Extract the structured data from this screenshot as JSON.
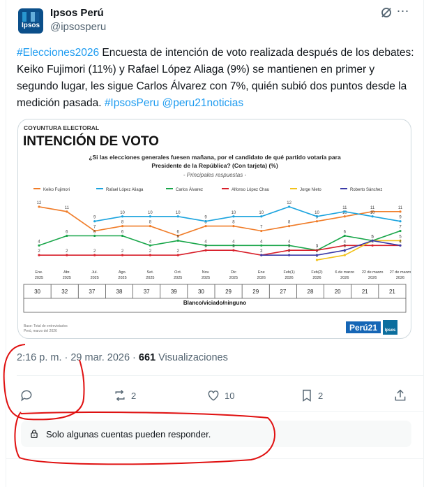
{
  "author": {
    "name": "Ipsos Perú",
    "handle": "@ipsosperu",
    "avatar_text": "Ipsos"
  },
  "tweet": {
    "hashtag1": "#Elecciones2026",
    "text1": " Encuesta de intención de voto realizada después de los debates: Keiko Fujimori (11%) y Rafael López Aliaga (9%) se mantienen en primer y segundo lugar, les sigue Carlos Álvarez con 7%, quién subió dos puntos desde la medición pasada. ",
    "hashtag2": "#IpsosPeru",
    "mention": "@peru21noticias"
  },
  "chart": {
    "kicker": "COYUNTURA ELECTORAL",
    "title": "INTENCIÓN DE VOTO",
    "question_line1": "¿Si las elecciones generales fuesen mañana, por el candidato de qué partido votaría para",
    "question_line2": "Presidente de la República? (Con tarjeta) (%)",
    "subtitle": "- Principales respuestas -",
    "footer_row_label": "Blanco/viciado/ninguno",
    "base_note_line1": "Base: Total de entrevistados",
    "base_note_line2": "Perú, marzo del 2026",
    "logo_text": "Perú21",
    "ipsos_logo": "Ipsos"
  },
  "chart_data": {
    "type": "line",
    "categories": [
      "Ene. 2025",
      "Abr. 2025",
      "Jul. 2025",
      "Ago. 2025",
      "Set. 2025",
      "Oct. 2025",
      "Nov. 2025",
      "Dic 2025",
      "Ene 2026",
      "Feb(1) 2026",
      "Feb(2) 2026",
      "6 de marzo 2026",
      "22 de marzo 2026",
      "27 de marzo 2026"
    ],
    "ylim": [
      0,
      13
    ],
    "series": [
      {
        "name": "Keiko Fujimori",
        "color": "#f07c28",
        "values": [
          12,
          11,
          7,
          8,
          8,
          6,
          8,
          8,
          7,
          8,
          9,
          10,
          11,
          11
        ]
      },
      {
        "name": "Rafael López Aliaga",
        "color": "#1aa3de",
        "values": [
          null,
          null,
          9,
          10,
          10,
          10,
          9,
          10,
          10,
          12,
          10,
          11,
          10,
          9
        ]
      },
      {
        "name": "Carlos Álvarez",
        "color": "#19a64a",
        "values": [
          4,
          6,
          6,
          6,
          4,
          5,
          4,
          4,
          4,
          4,
          3,
          6,
          5,
          7
        ]
      },
      {
        "name": "Alfonso López Chau",
        "color": "#d81f2a",
        "values": [
          2,
          2,
          2,
          2,
          2,
          2,
          3,
          3,
          2,
          3,
          3,
          4,
          4,
          4
        ]
      },
      {
        "name": "Jorge Nieto",
        "color": "#f2c21b",
        "values": [
          null,
          null,
          null,
          null,
          null,
          null,
          null,
          null,
          null,
          null,
          1,
          2,
          5,
          5
        ]
      },
      {
        "name": "Roberto Sánchez",
        "color": "#3a3aa8",
        "values": [
          null,
          null,
          null,
          null,
          null,
          null,
          null,
          null,
          2,
          2,
          2,
          3,
          5,
          4
        ]
      }
    ],
    "table": {
      "label": "Blanco/viciado/ninguno",
      "values": [
        30,
        32,
        37,
        38,
        37,
        39,
        30,
        29,
        29,
        27,
        28,
        20,
        21,
        21
      ]
    }
  },
  "meta": {
    "time": "2:16 p. m. · 29 mar. 2026 · ",
    "views_count": "661",
    "views_label": " Visualizaciones"
  },
  "actions": {
    "retweets": "2",
    "likes": "10",
    "bookmarks": "2"
  },
  "reply_restriction": "Solo algunas cuentas pueden responder."
}
